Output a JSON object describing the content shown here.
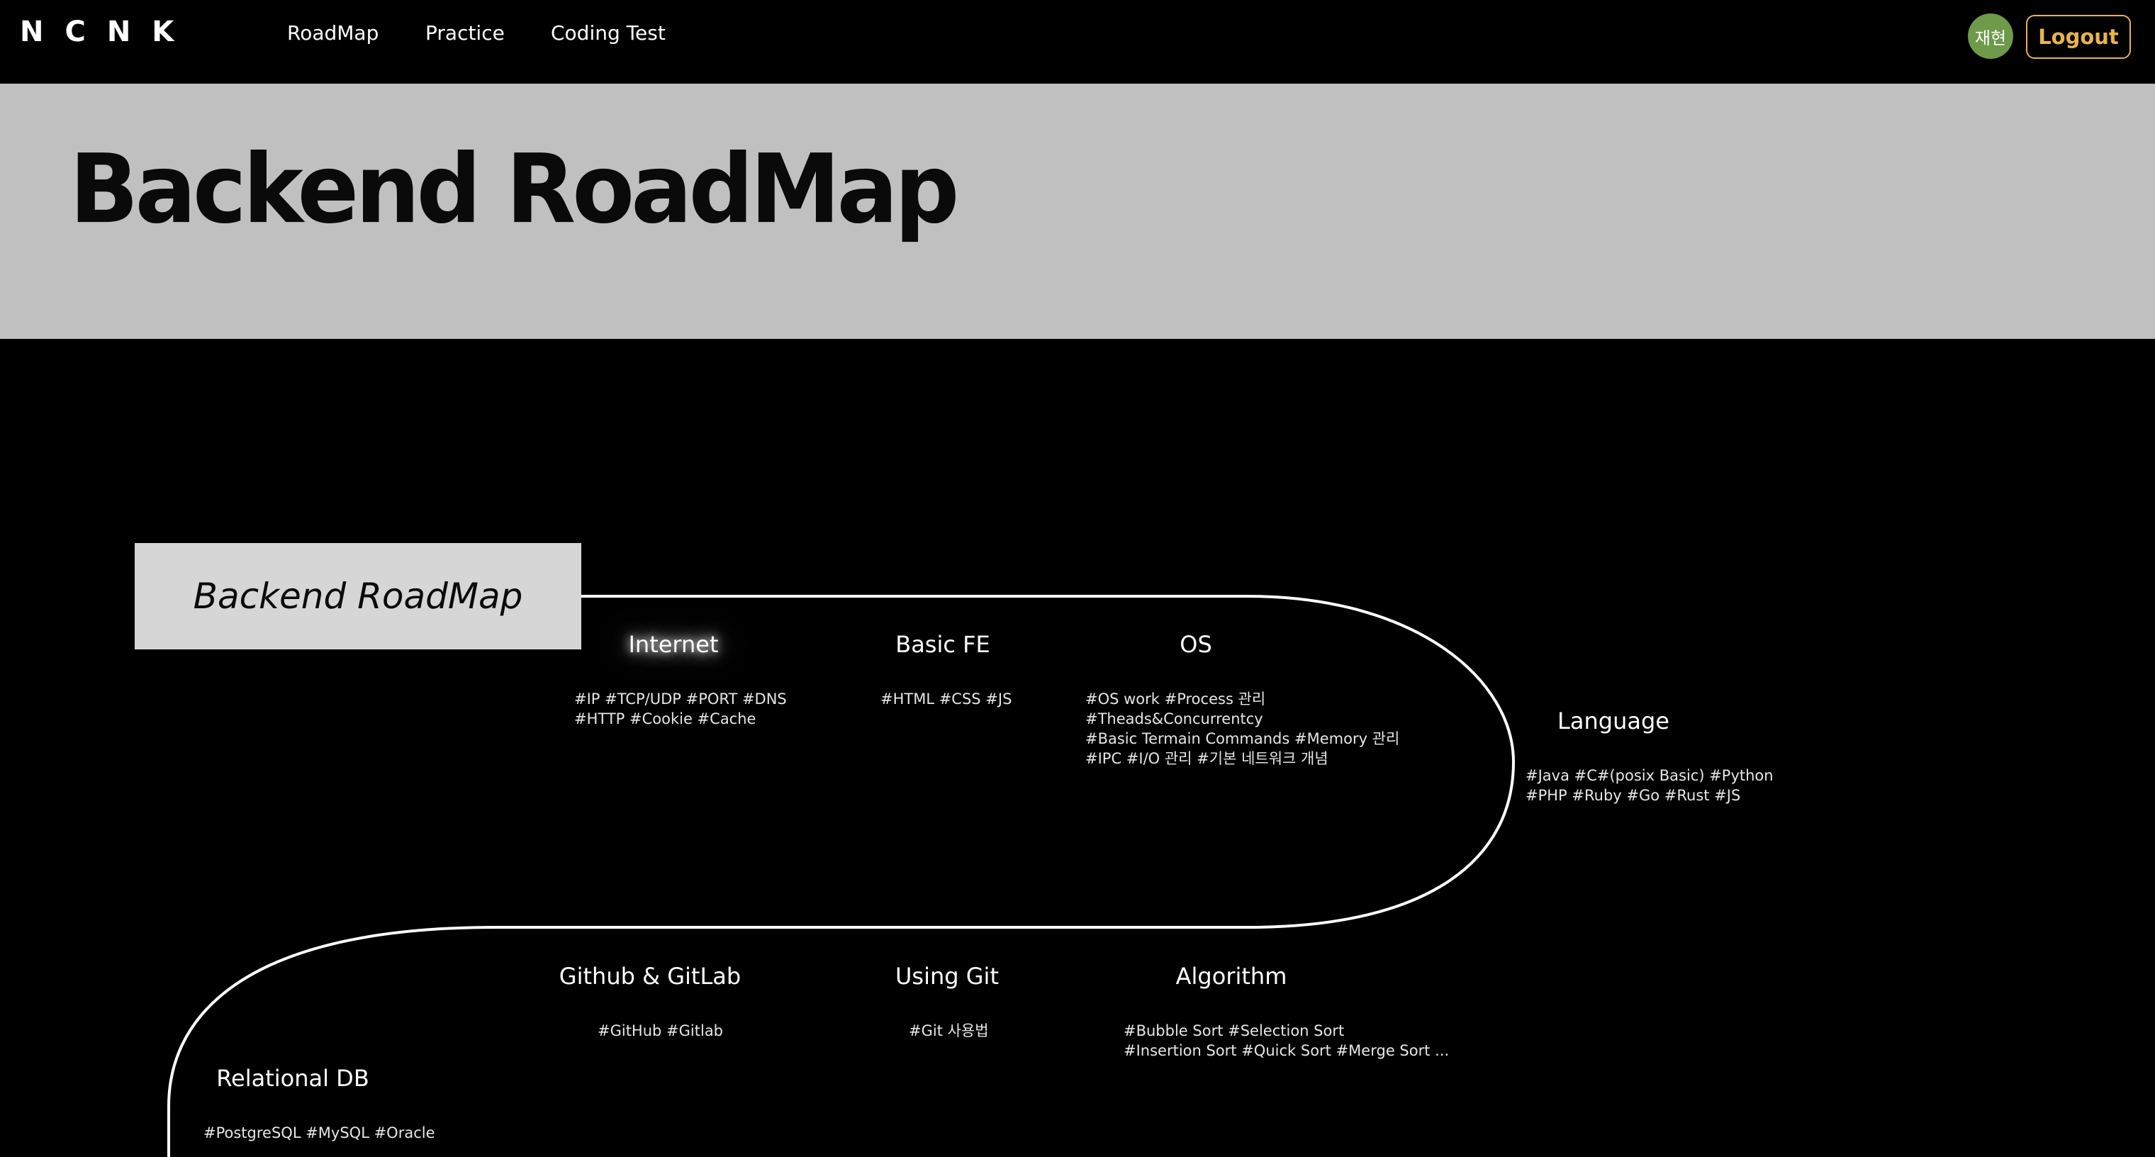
{
  "header": {
    "logo": "NCNK",
    "nav": [
      {
        "label": "RoadMap"
      },
      {
        "label": "Practice"
      },
      {
        "label": "Coding Test"
      }
    ],
    "user_avatar": "재현",
    "logout_label": "Logout",
    "accent_color": "#e7b54a",
    "avatar_color": "#6e9a4a"
  },
  "banner": {
    "title": "Backend RoadMap"
  },
  "roadmap": {
    "start_label": "Backend RoadMap",
    "nodes": [
      {
        "title": "Internet",
        "tags": "#IP #TCP/UDP #PORT #DNS\n#HTTP #Cookie #Cache",
        "active": true
      },
      {
        "title": "Basic FE",
        "tags": "#HTML #CSS #JS"
      },
      {
        "title": "OS",
        "tags": "#OS work #Process 관리\n#Theads&Concurrentcy\n#Basic Termain Commands #Memory 관리\n#IPC #I/O 관리 #기본 네트워크 개념"
      },
      {
        "title": "Language",
        "tags": "#Java #C#(posix Basic) #Python\n#PHP #Ruby #Go #Rust #JS"
      },
      {
        "title": "Github & GitLab",
        "tags": "#GitHub #Gitlab"
      },
      {
        "title": "Using Git",
        "tags": "#Git 사용법"
      },
      {
        "title": "Algorithm",
        "tags": "#Bubble Sort #Selection Sort\n#Insertion Sort #Quick Sort #Merge Sort ..."
      },
      {
        "title": "Relational DB",
        "tags": "#PostgreSQL #MySQL #Oracle"
      }
    ]
  }
}
